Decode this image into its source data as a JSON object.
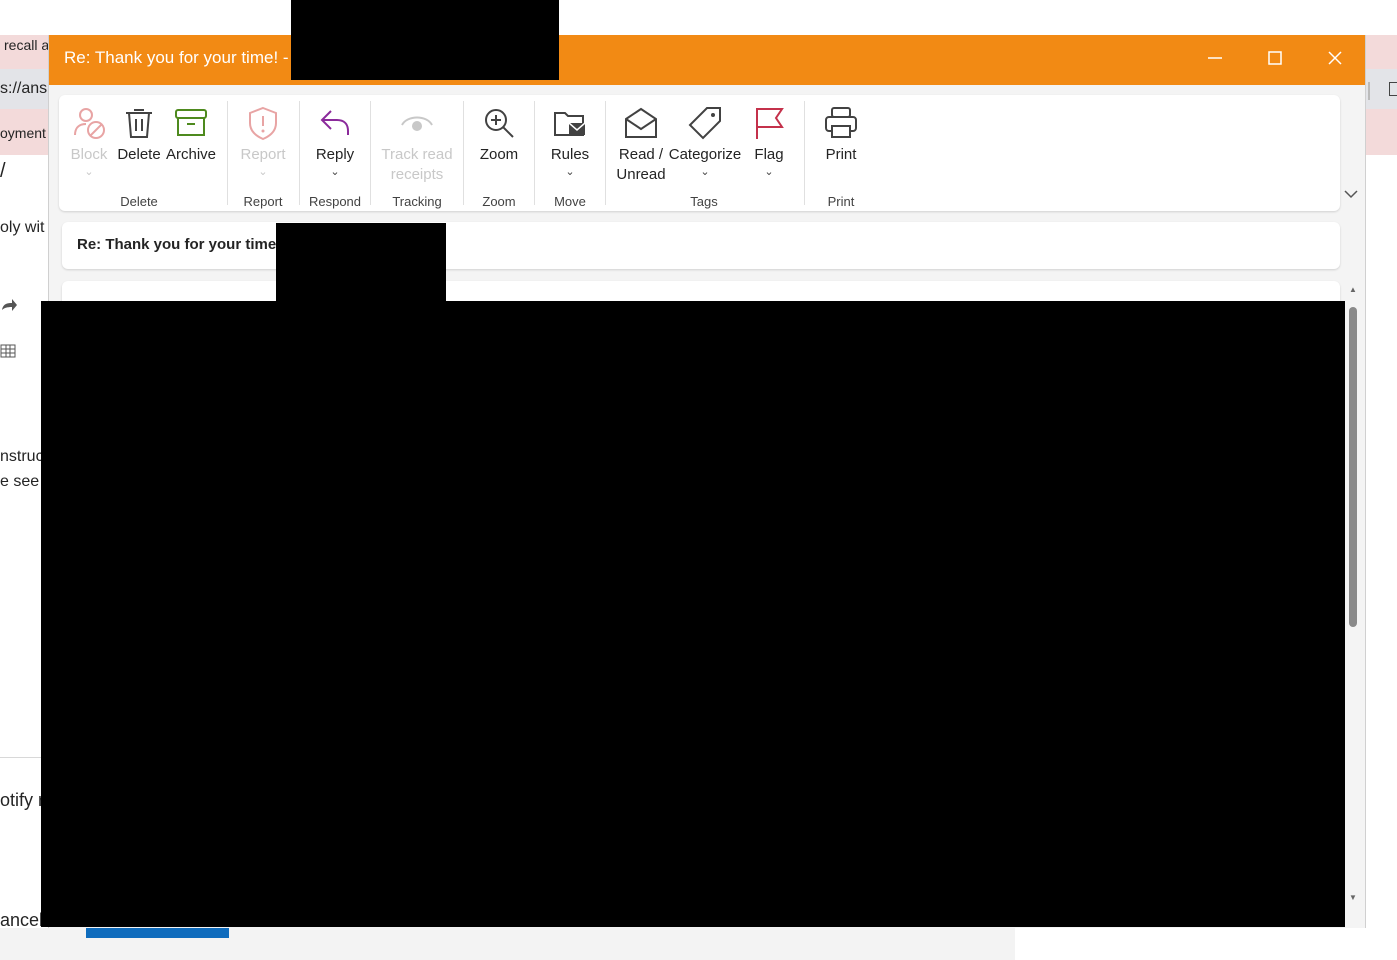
{
  "background": {
    "fragments": [
      "recall a",
      "s://ans",
      "oyment",
      "/",
      "oly wit",
      "nstruc",
      "e see t",
      "otify r",
      "ancel"
    ]
  },
  "window": {
    "title": "Re: Thank you for your time! -",
    "controls": {
      "minimize_icon": "minimize-icon",
      "maximize_icon": "maximize-icon",
      "close_icon": "close-icon"
    }
  },
  "ribbon": {
    "buttons": {
      "block": "Block",
      "delete": "Delete",
      "archive": "Archive",
      "report": "Report",
      "reply": "Reply",
      "track_line1": "Track read",
      "track_line2": "receipts",
      "zoom": "Zoom",
      "rules": "Rules",
      "read_line1": "Read /",
      "read_line2": "Unread",
      "categorize": "Categorize",
      "flag": "Flag",
      "print": "Print"
    },
    "groups": {
      "delete": "Delete",
      "report": "Report",
      "respond": "Respond",
      "tracking": "Tracking",
      "zoom": "Zoom",
      "move": "Move",
      "tags": "Tags",
      "print": "Print"
    },
    "colors": {
      "accent": "#f28a14",
      "reply_icon": "#8b2a9b",
      "archive_icon": "#4e8a1e",
      "flag_icon": "#c4314b",
      "block_icon": "#e8a4a4"
    }
  },
  "message": {
    "subject": "Re: Thank you for your time! -"
  }
}
